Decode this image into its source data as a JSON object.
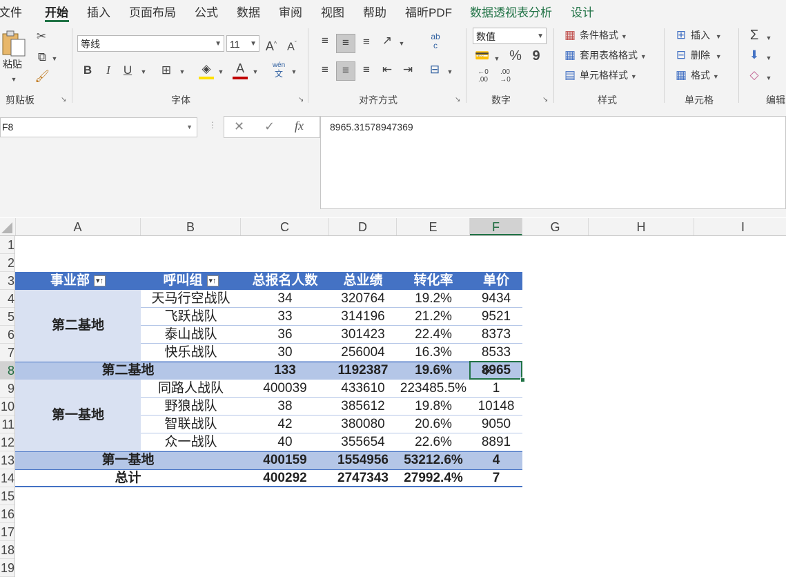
{
  "menu": {
    "tabs": [
      "文件",
      "开始",
      "插入",
      "页面布局",
      "公式",
      "数据",
      "审阅",
      "视图",
      "帮助",
      "福昕PDF",
      "数据透视表分析",
      "设计"
    ]
  },
  "ribbon": {
    "clipboard": {
      "paste": "粘贴",
      "group": "剪贴板"
    },
    "font": {
      "name": "等线",
      "size": "11",
      "grow": "A",
      "shrink": "A",
      "bold": "B",
      "italic": "I",
      "underline": "U",
      "wen": "wén",
      "wen_char": "文",
      "font_color_letter": "A",
      "group": "字体"
    },
    "align": {
      "group": "对齐方式",
      "wrap_top": "ab",
      "wrap_bottom": "c"
    },
    "number": {
      "format": "数值",
      "percent": "%",
      "comma": "9",
      "inc": "←0\n.00",
      "group": "数字"
    },
    "styles": {
      "cond": "条件格式",
      "table": "套用表格格式",
      "cell": "单元格样式",
      "group": "样式"
    },
    "cells": {
      "insert": "插入",
      "delete": "删除",
      "format": "格式",
      "group": "单元格"
    },
    "editing": {
      "sum": "Σ",
      "group": "编辑"
    }
  },
  "formula_bar": {
    "name_box": "F8",
    "cancel": "✕",
    "enter": "✓",
    "fx": "fx",
    "value": "8965.31578947369"
  },
  "columns": [
    "A",
    "B",
    "C",
    "D",
    "E",
    "F",
    "G",
    "H",
    "I"
  ],
  "rows": [
    "1",
    "2",
    "3",
    "4",
    "5",
    "6",
    "7",
    "8",
    "9",
    "10",
    "11",
    "12",
    "13",
    "14",
    "15",
    "16",
    "17",
    "18",
    "19"
  ],
  "pivot": {
    "headers": [
      "事业部",
      "呼叫组",
      "总报名人数",
      "总业绩",
      "转化率",
      "单价"
    ],
    "group1": {
      "name": "第二基地",
      "rows": [
        [
          "天马行空战队",
          "34",
          "320764",
          "19.2%",
          "9434"
        ],
        [
          "飞跃战队",
          "33",
          "314196",
          "21.2%",
          "9521"
        ],
        [
          "泰山战队",
          "36",
          "301423",
          "22.4%",
          "8373"
        ],
        [
          "快乐战队",
          "30",
          "256004",
          "16.3%",
          "8533"
        ]
      ],
      "subtotal": [
        "第二基地",
        "133",
        "1192387",
        "19.6%",
        "8965"
      ]
    },
    "group2": {
      "name": "第一基地",
      "rows": [
        [
          "同路人战队",
          "400039",
          "433610",
          "223485.5%",
          "1"
        ],
        [
          "野狼战队",
          "38",
          "385612",
          "19.8%",
          "10148"
        ],
        [
          "智联战队",
          "42",
          "380080",
          "20.6%",
          "9050"
        ],
        [
          "众一战队",
          "40",
          "355654",
          "22.6%",
          "8891"
        ]
      ],
      "subtotal": [
        "第一基地",
        "400159",
        "1554956",
        "53212.6%",
        "4"
      ]
    },
    "total": [
      "总计",
      "400292",
      "2747343",
      "27992.4%",
      "7"
    ]
  },
  "colors": {
    "header_blue": "#4472c4",
    "band_light": "#d9e1f2",
    "band_mid": "#b4c6e7",
    "accent_green": "#217346"
  }
}
